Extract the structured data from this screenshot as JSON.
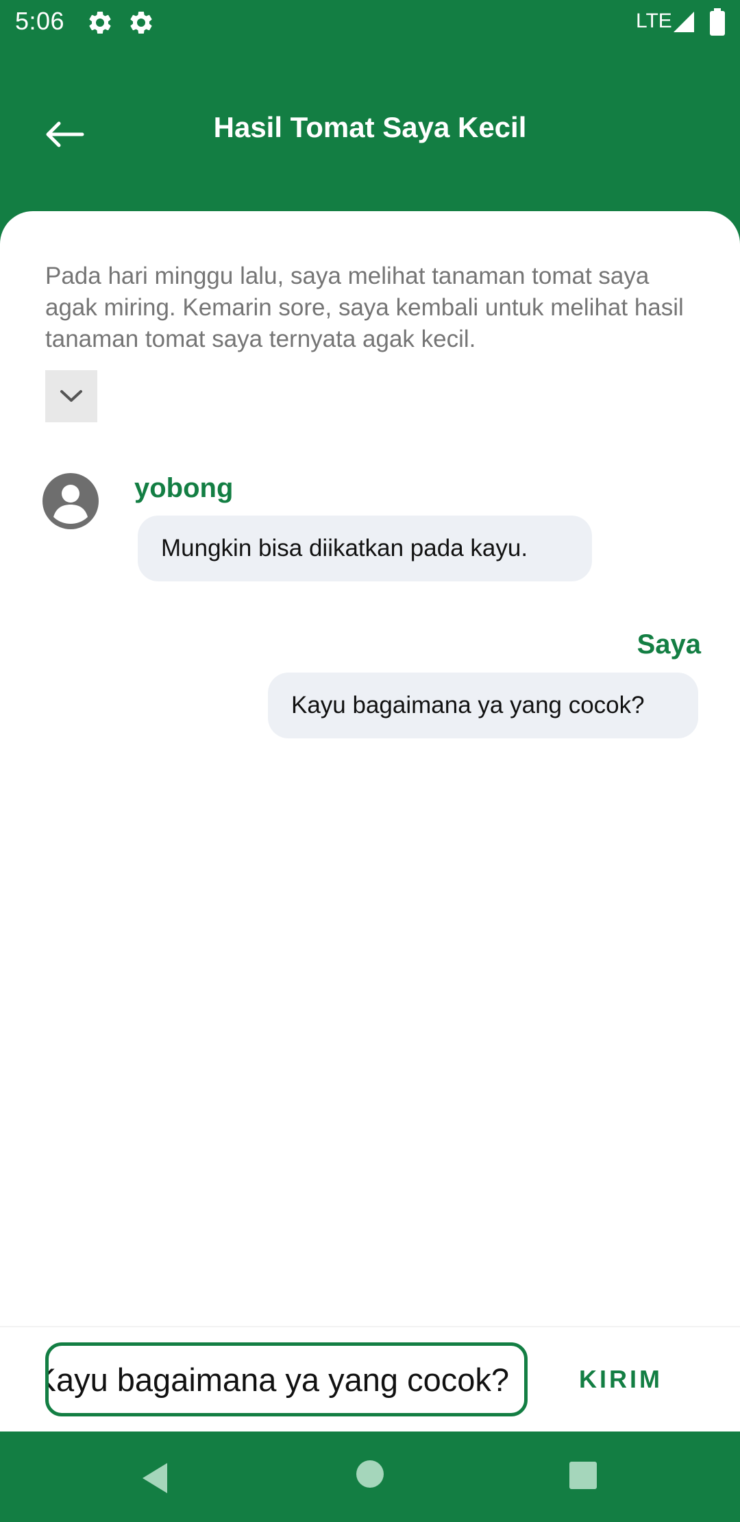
{
  "status_bar": {
    "time": "5:06",
    "network": "LTE",
    "icons": [
      "gear-icon",
      "gear-icon",
      "signal-icon",
      "battery-icon"
    ]
  },
  "header": {
    "title": "Hasil Tomat Saya Kecil",
    "back_icon": "arrow-left-icon"
  },
  "post": {
    "body": "Pada hari minggu lalu, saya melihat tanaman tomat saya agak miring. Kemarin sore, saya kembali untuk melihat hasil tanaman tomat saya ternyata agak kecil.",
    "expand_icon": "chevron-down-icon"
  },
  "comments": [
    {
      "author": "yobong",
      "text": "Mungkin bisa diikatkan pada kayu.",
      "avatar_icon": "person-avatar-icon"
    },
    {
      "author": "Saya",
      "text": "Kayu bagaimana ya yang cocok?"
    }
  ],
  "composer": {
    "value": "Kayu bagaimana ya yang cocok?",
    "send_label": "KIRIM"
  },
  "nav_bar": {
    "icons": [
      "back-triangle-icon",
      "home-circle-icon",
      "recents-square-icon"
    ]
  },
  "colors": {
    "primary": "#137e43",
    "bubble": "#edf0f5",
    "body_text": "#757575"
  }
}
